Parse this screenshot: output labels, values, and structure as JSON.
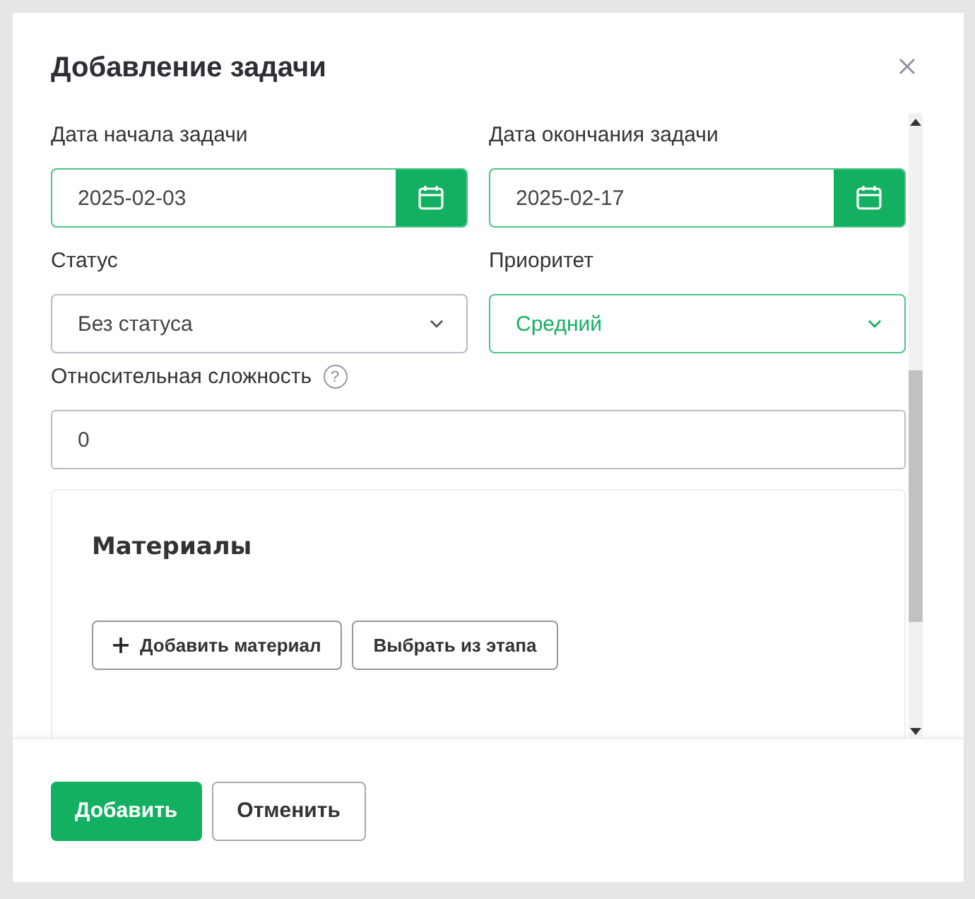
{
  "dialog": {
    "title": "Добавление задачи"
  },
  "date_fields": [
    {
      "label": "Дата начала задачи",
      "value": "2025-02-03",
      "highlighted": true
    },
    {
      "label": "Дата окончания задачи",
      "value": "2025-02-17",
      "highlighted": true
    }
  ],
  "select_fields": [
    {
      "label": "Статус",
      "value": "Без статуса",
      "highlighted": false
    },
    {
      "label": "Приоритет",
      "value": "Средний",
      "highlighted": true
    }
  ],
  "complexity": {
    "label": "Относительная сложность",
    "value": "0",
    "help": "?"
  },
  "materials": {
    "title": "Материалы",
    "buttons": [
      {
        "label": "Добавить материал",
        "kind": "add"
      },
      {
        "label": "Выбрать из этапа",
        "kind": "plain"
      }
    ]
  },
  "footer_buttons": [
    {
      "label": "Добавить",
      "kind": "primary"
    },
    {
      "label": "Отменить",
      "kind": "secondary"
    }
  ]
}
